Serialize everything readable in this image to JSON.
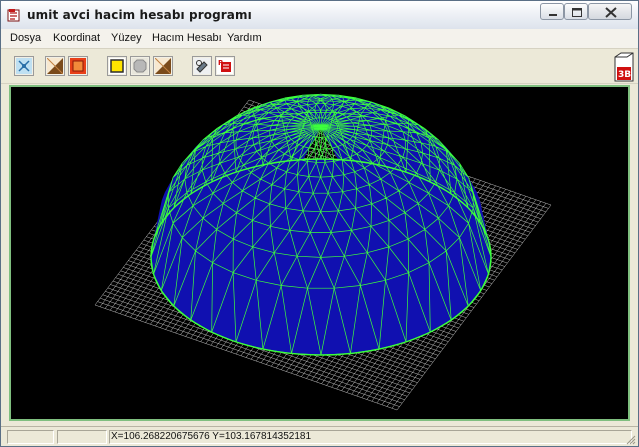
{
  "window": {
    "title": "umit avci hacim hesabı programı"
  },
  "menu": {
    "items": [
      "Dosya",
      "Koordinat",
      "Yüzey",
      "Hacım Hesabı",
      "Yardım"
    ]
  },
  "toolbar": {
    "buttons": [
      {
        "icon": "xyz-points-icon"
      },
      {
        "icon": "surface-icon"
      },
      {
        "icon": "fill-red-icon"
      },
      {
        "icon": "yellow-box-icon"
      },
      {
        "icon": "octagon-icon"
      },
      {
        "icon": "surface-2-icon"
      },
      {
        "icon": "tools-icon"
      },
      {
        "icon": "ruler-red-icon"
      }
    ],
    "view3d_label": "3B"
  },
  "status": {
    "coords": "X=106.268220675676  Y=103.167814352181"
  },
  "colors": {
    "canvas_bg": "#000000",
    "grid_plane": "#c0c0c0",
    "surface_fill": "#1010b0",
    "mesh_lines": "#3cff3c"
  }
}
